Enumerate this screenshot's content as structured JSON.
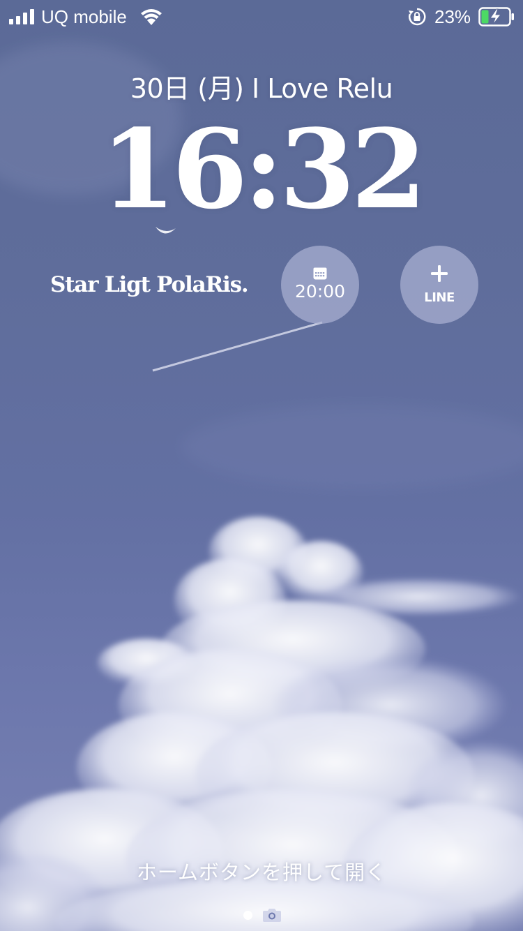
{
  "status_bar": {
    "carrier": "UQ mobile",
    "battery_percent": "23%",
    "icons": [
      "signal-bars-icon",
      "wifi-icon",
      "rotation-lock-icon",
      "battery-charging-icon"
    ]
  },
  "lock_screen": {
    "date_line": "30日 (月)  I Love Relu",
    "time": "16:32"
  },
  "widgets": {
    "text_widget": "Star Ligt PolaRis.",
    "calendar": {
      "time": "20:00",
      "icon": "calendar-icon"
    },
    "line_shortcut": {
      "label": "LINE",
      "icon": "plus-icon"
    }
  },
  "bottom": {
    "unlock_hint": "ホームボタンを押して開く",
    "page_indicator": "page-dot",
    "camera": "camera-icon"
  },
  "colors": {
    "sky_top": "#5b6a97",
    "sky_bottom": "#7a83b4",
    "widget_circle": "#aab2d2",
    "battery_fill": "#4cd964"
  }
}
